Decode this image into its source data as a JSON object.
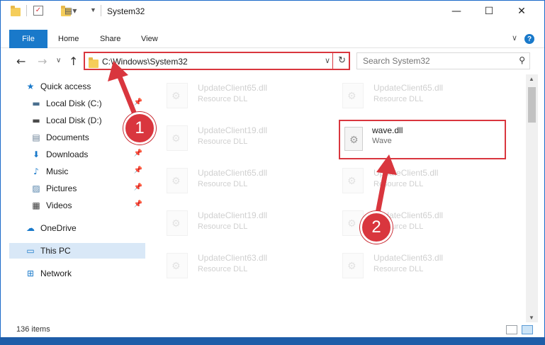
{
  "window": {
    "title": "System32",
    "controls": {
      "minimize": "—",
      "maximize": "☐",
      "close": "✕"
    }
  },
  "ribbon": {
    "file_tab": "File",
    "tabs": [
      "Home",
      "Share",
      "View"
    ],
    "help": "?",
    "collapse": "∨"
  },
  "nav": {
    "back": "←",
    "forward": "→",
    "up": "↑",
    "recent": "∨",
    "address": "C:\\Windows\\System32",
    "address_dropdown": "∨",
    "refresh": "↻",
    "search_placeholder": "Search System32",
    "search_icon": "⚲"
  },
  "sidebar": {
    "items": [
      {
        "label": "Quick access",
        "icon": "star-icon",
        "glyph": "★",
        "color": "#1979ca",
        "pinned": false
      },
      {
        "label": "Local Disk (C:)",
        "icon": "drive-icon",
        "glyph": "▬",
        "color": "#4a6f8f",
        "pinned": true
      },
      {
        "label": "Local Disk (D:)",
        "icon": "drive-icon",
        "glyph": "▬",
        "color": "#4a4a4a",
        "pinned": false
      },
      {
        "label": "Documents",
        "icon": "documents-icon",
        "glyph": "▤",
        "color": "#6a7f95",
        "pinned": false
      },
      {
        "label": "Downloads",
        "icon": "downloads-icon",
        "glyph": "⬇",
        "color": "#1979ca",
        "pinned": true
      },
      {
        "label": "Music",
        "icon": "music-icon",
        "glyph": "♪",
        "color": "#1979ca",
        "pinned": true
      },
      {
        "label": "Pictures",
        "icon": "pictures-icon",
        "glyph": "▨",
        "color": "#4f7fa8",
        "pinned": true
      },
      {
        "label": "Videos",
        "icon": "videos-icon",
        "glyph": "▦",
        "color": "#3b3b3b",
        "pinned": true
      },
      {
        "label": "OneDrive",
        "icon": "onedrive-icon",
        "glyph": "☁",
        "color": "#1979ca",
        "pinned": false
      },
      {
        "label": "This PC",
        "icon": "pc-icon",
        "glyph": "▭",
        "color": "#1979ca",
        "pinned": false,
        "selected": true
      },
      {
        "label": "Network",
        "icon": "network-icon",
        "glyph": "⊞",
        "color": "#1979ca",
        "pinned": false
      }
    ],
    "pin_glyph": "📌"
  },
  "files": [
    {
      "name": "UpdateClient65.dll",
      "type": "Resource DLL",
      "faded": true
    },
    {
      "name": "UpdateClient65.dll",
      "type": "Resource DLL",
      "faded": true
    },
    {
      "name": "UpdateClient19.dll",
      "type": "Resource DLL",
      "faded": true
    },
    {
      "name": "wave.dll",
      "type": "Wave",
      "faded": false
    },
    {
      "name": "UpdateClient65.dll",
      "type": "Resource DLL",
      "faded": true
    },
    {
      "name": "UpdateClient5.dll",
      "type": "Resource DLL",
      "faded": true
    },
    {
      "name": "UpdateClient19.dll",
      "type": "Resource DLL",
      "faded": true
    },
    {
      "name": "UpdateClient65.dll",
      "type": "Resource DLL",
      "faded": true
    },
    {
      "name": "UpdateClient63.dll",
      "type": "Resource DLL",
      "faded": true
    },
    {
      "name": "UpdateClient63.dll",
      "type": "Resource DLL",
      "faded": true
    }
  ],
  "status": {
    "items_count": "136 items"
  },
  "annotations": {
    "step1": "1",
    "step2": "2",
    "color": "#d9363e"
  }
}
